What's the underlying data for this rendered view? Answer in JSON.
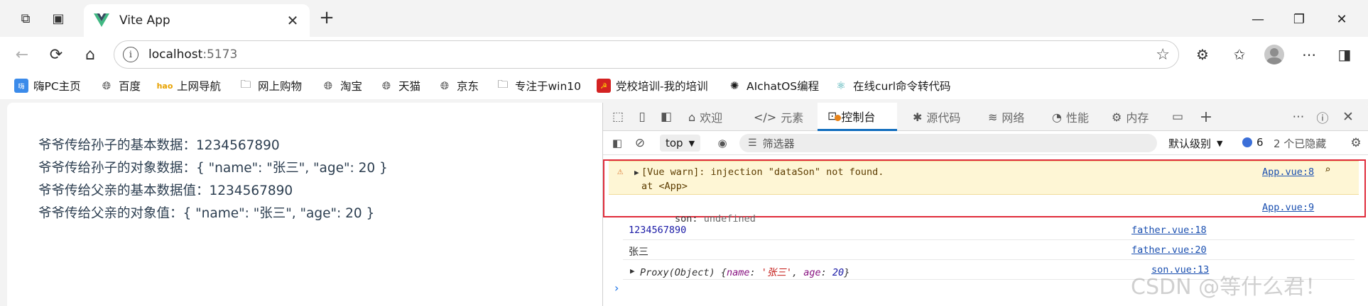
{
  "browser": {
    "tab_title": "Vite App",
    "url_host": "localhost",
    "url_port": ":5173"
  },
  "bookmarks": [
    {
      "label": "嗨PC主页",
      "icon": "hipc-icon"
    },
    {
      "label": "百度",
      "icon": "globe-icon"
    },
    {
      "label": "上网导航",
      "icon": "hao-icon"
    },
    {
      "label": "网上购物",
      "icon": "folder-icon"
    },
    {
      "label": "淘宝",
      "icon": "globe-icon"
    },
    {
      "label": "天猫",
      "icon": "globe-icon"
    },
    {
      "label": "京东",
      "icon": "globe-icon"
    },
    {
      "label": "专注于win10",
      "icon": "folder-icon"
    },
    {
      "label": "党校培训-我的培训",
      "icon": "party-icon"
    },
    {
      "label": "AIchatOS编程",
      "icon": "openai-icon"
    },
    {
      "label": "在线curl命令转代码",
      "icon": "react-icon"
    }
  ],
  "page": {
    "lines": [
      "爷爷传给孙子的基本数据：1234567890",
      "爷爷传给孙子的对象数据：{ \"name\": \"张三\", \"age\": 20 }",
      "爷爷传给父亲的基本数据值：1234567890",
      "爷爷传给父亲的对象值：{ \"name\": \"张三\", \"age\": 20 }"
    ]
  },
  "devtools": {
    "tabs": [
      {
        "label": "欢迎",
        "icon": "home-icon"
      },
      {
        "label": "元素",
        "icon": "code-icon"
      },
      {
        "label": "控制台",
        "icon": "console-icon",
        "active": true
      },
      {
        "label": "源代码",
        "icon": "bug-icon"
      },
      {
        "label": "网络",
        "icon": "wifi-icon"
      },
      {
        "label": "性能",
        "icon": "gauge-icon"
      },
      {
        "label": "内存",
        "icon": "memory-icon"
      }
    ],
    "context": "top",
    "filter_placeholder": "筛选器",
    "level": "默认级别",
    "issues_count": "6",
    "hidden": "2 个已隐藏"
  },
  "console": {
    "warn_message": "[Vue warn]: injection \"dataSon\" not found.",
    "warn_at": "at <App>",
    "warn_source": "App.vue:8",
    "son_label": "son:",
    "son_value": "undefined",
    "son_source": "App.vue:9",
    "num_value": "1234567890",
    "num_source": "father.vue:18",
    "name_value": "张三",
    "name_source": "father.vue:20",
    "proxy_prefix": "Proxy(Object)",
    "proxy_open": "{",
    "proxy_key1": "name",
    "proxy_sep1": ": ",
    "proxy_val1": "'张三'",
    "proxy_comma": ", ",
    "proxy_key2": "age",
    "proxy_sep2": ": ",
    "proxy_val2": "20",
    "proxy_close": "}",
    "proxy_source": "son.vue:13",
    "prompt": "›"
  },
  "watermark": "CSDN @等什么君！",
  "colors": {
    "active_tab_underline": "#0f6cbd",
    "warn_bg": "#fef6d5",
    "highlight_border": "#e02b3a",
    "link": "#1a4fb0"
  }
}
